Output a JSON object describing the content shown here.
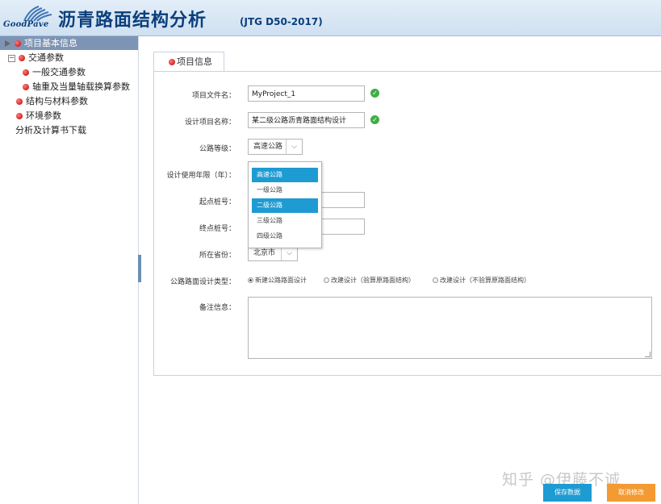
{
  "header": {
    "logo_text": "GoodPave",
    "title": "沥青路面结构分析",
    "subtitle": "(JTG D50-2017)"
  },
  "sidebar": {
    "items": [
      {
        "label": "项目基本信息"
      },
      {
        "label": "交通参数"
      },
      {
        "label": "一般交通参数"
      },
      {
        "label": "轴重及当量轴载换算参数"
      },
      {
        "label": "结构与材料参数"
      },
      {
        "label": "环境参数"
      },
      {
        "label": "分析及计算书下载"
      }
    ]
  },
  "tab": {
    "label": "项目信息"
  },
  "form": {
    "file_name": {
      "label": "项目文件名：",
      "value": "MyProject_1"
    },
    "project_name": {
      "label": "设计项目名称：",
      "value": "某二级公路沥青路面结构设计"
    },
    "road_grade": {
      "label": "公路等级：",
      "value": "高速公路",
      "options": [
        "高速公路",
        "一级公路",
        "二级公路",
        "三级公路",
        "四级公路"
      ]
    },
    "design_life": {
      "label": "设计使用年限（年）："
    },
    "start_station": {
      "label": "起点桩号："
    },
    "end_station": {
      "label": "终点桩号："
    },
    "province": {
      "label": "所在省份：",
      "value": "北京市"
    },
    "design_type": {
      "label": "公路路面设计类型：",
      "options": [
        "新建公路路面设计",
        "改建设计（验算原路面结构）",
        "改建设计（不验算原路面结构）"
      ]
    },
    "remarks": {
      "label": "备注信息："
    }
  },
  "buttons": {
    "save": "保存数据",
    "cancel": "取消修改"
  },
  "watermark": "知乎 @伊藤不诚",
  "colors": {
    "accent": "#1e9bd2",
    "cancel": "#f39a32",
    "save": "#1e9bd2",
    "title": "#0b3f7c"
  }
}
